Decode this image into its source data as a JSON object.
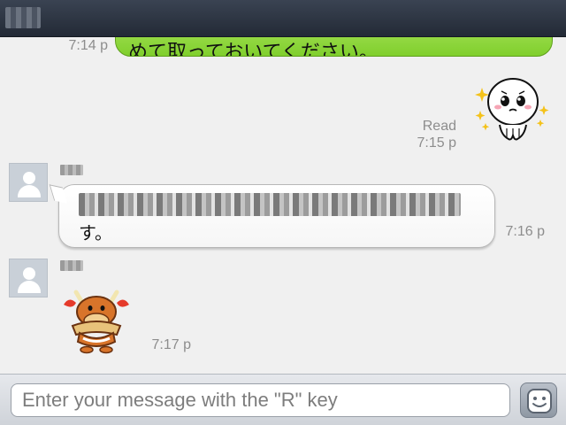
{
  "header": {
    "title": "■■■"
  },
  "messages": [
    {
      "kind": "outgoing",
      "text": "めて取っておいてください。",
      "time": "7:14 p"
    },
    {
      "kind": "outgoing-sticker",
      "sticker": "crying-face-sticker",
      "status": "Read",
      "time": "7:15 p"
    },
    {
      "kind": "incoming",
      "sender": "■■",
      "text_line1": "■■■■■■■■■■■■■■■■■■■■■■■■■■■■■",
      "text_line2": "す。",
      "time": "7:16 p"
    },
    {
      "kind": "incoming-sticker",
      "sender": "■■",
      "sticker": "bull-holding-bread-sticker",
      "time": "7:17 p"
    }
  ],
  "composer": {
    "placeholder": "Enter your message with the \"R\" key"
  },
  "colors": {
    "outgoing_bubble": "#8fd83f",
    "header": "#2d3441",
    "background": "#f0f0f0"
  }
}
